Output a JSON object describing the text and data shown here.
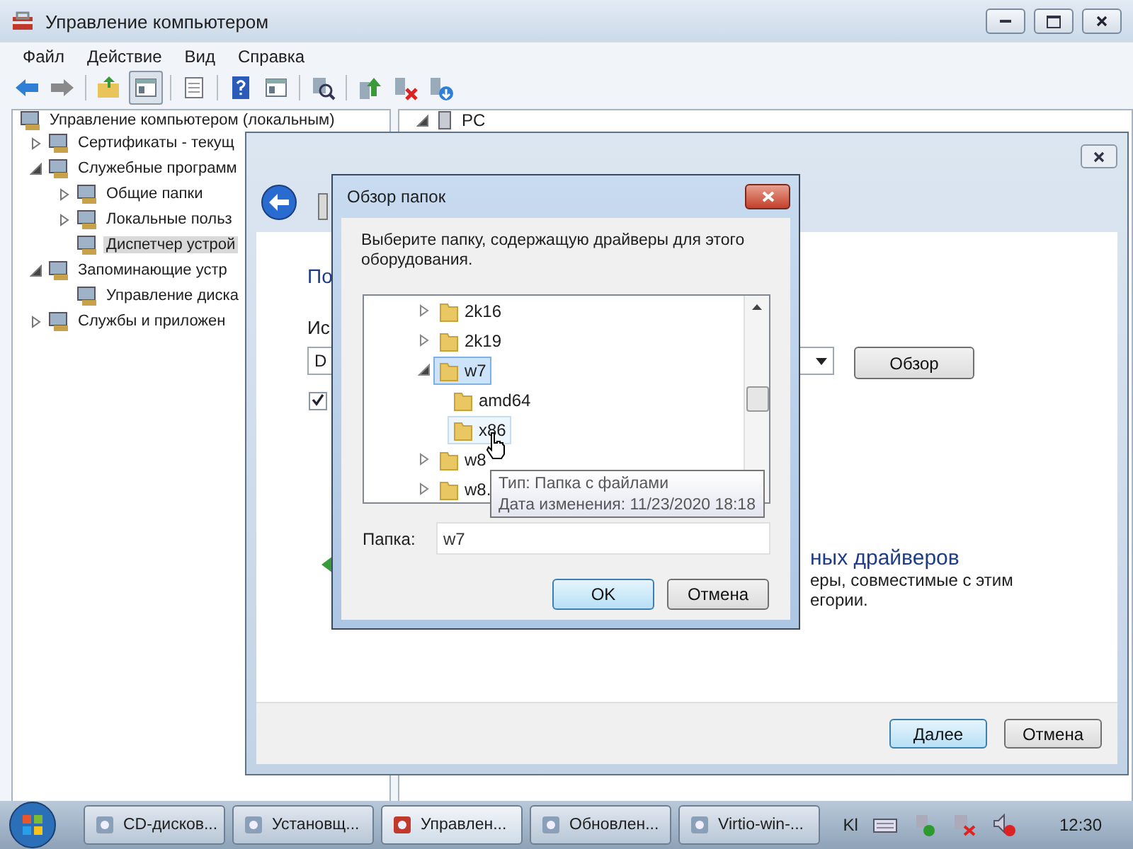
{
  "window": {
    "title": "Управление компьютером"
  },
  "menu": [
    {
      "label": "Файл"
    },
    {
      "label": "Действие"
    },
    {
      "label": "Вид"
    },
    {
      "label": "Справка"
    }
  ],
  "tree": [
    {
      "label": "Управление компьютером (локальным)",
      "expandable": false,
      "selected": false,
      "children": [
        {
          "label": "Сертификаты - текущ",
          "expandable": true,
          "expanded": false,
          "selected": false
        },
        {
          "label": "Служебные программ",
          "expandable": true,
          "expanded": true,
          "selected": false,
          "children": [
            {
              "label": "Общие папки",
              "expandable": true,
              "expanded": false,
              "selected": false
            },
            {
              "label": "Локальные польз",
              "expandable": true,
              "expanded": false,
              "selected": false
            },
            {
              "label": "Диспетчер устрой",
              "expandable": false,
              "selected": true
            }
          ]
        },
        {
          "label": "Запоминающие устр",
          "expandable": true,
          "expanded": true,
          "selected": false,
          "children": [
            {
              "label": "Управление диска",
              "expandable": false,
              "selected": false
            }
          ]
        },
        {
          "label": "Службы и приложен",
          "expandable": true,
          "expanded": false,
          "selected": false
        }
      ]
    }
  ],
  "right_pane": {
    "items": [
      {
        "label": "PC",
        "expandable": true,
        "expanded": true
      }
    ]
  },
  "wizard": {
    "heading": "По",
    "source_label": "Ис",
    "path_value": "D",
    "browse_button": "Обзор",
    "include_subfolders": {
      "checked": true
    },
    "option_title": "ных драйверов",
    "option_text_lines": [
      "еры, совместимые с этим",
      "егории."
    ],
    "buttons": [
      {
        "label": "Далее",
        "default": true
      },
      {
        "label": "Отмена",
        "default": false
      }
    ]
  },
  "browse_dialog": {
    "title": "Обзор папок",
    "instruction": "Выберите папку, содержащую драйверы для этого оборудования.",
    "folders": [
      {
        "label": "2k16",
        "expandable": true,
        "expanded": false,
        "selected": false,
        "hovered": false
      },
      {
        "label": "2k19",
        "expandable": true,
        "expanded": false,
        "selected": false,
        "hovered": false
      },
      {
        "label": "w7",
        "expandable": true,
        "expanded": true,
        "selected": true,
        "hovered": false,
        "children": [
          {
            "label": "amd64",
            "expandable": false,
            "selected": false,
            "hovered": false
          },
          {
            "label": "x86",
            "expandable": false,
            "selected": false,
            "hovered": true
          }
        ]
      },
      {
        "label": "w8",
        "expandable": true,
        "expanded": false,
        "selected": false,
        "hovered": false
      },
      {
        "label": "w8.",
        "expandable": true,
        "expanded": false,
        "selected": false,
        "hovered": false
      }
    ],
    "folder_label": "Папка:",
    "folder_value": "w7",
    "buttons": [
      {
        "label": "OK",
        "default": true
      },
      {
        "label": "Отмена",
        "default": false
      }
    ]
  },
  "tooltip": {
    "lines": [
      "Тип: Папка с файлами",
      "Дата изменения: 11/23/2020 18:18"
    ]
  },
  "taskbar": {
    "buttons": [
      {
        "label": "CD-дисков...",
        "active": false
      },
      {
        "label": "Установщ...",
        "active": false
      },
      {
        "label": "Управлен...",
        "active": true
      },
      {
        "label": "Обновлен...",
        "active": false
      },
      {
        "label": "Virtio-win-...",
        "active": false
      }
    ],
    "language": "Kl",
    "clock": "12:30"
  }
}
